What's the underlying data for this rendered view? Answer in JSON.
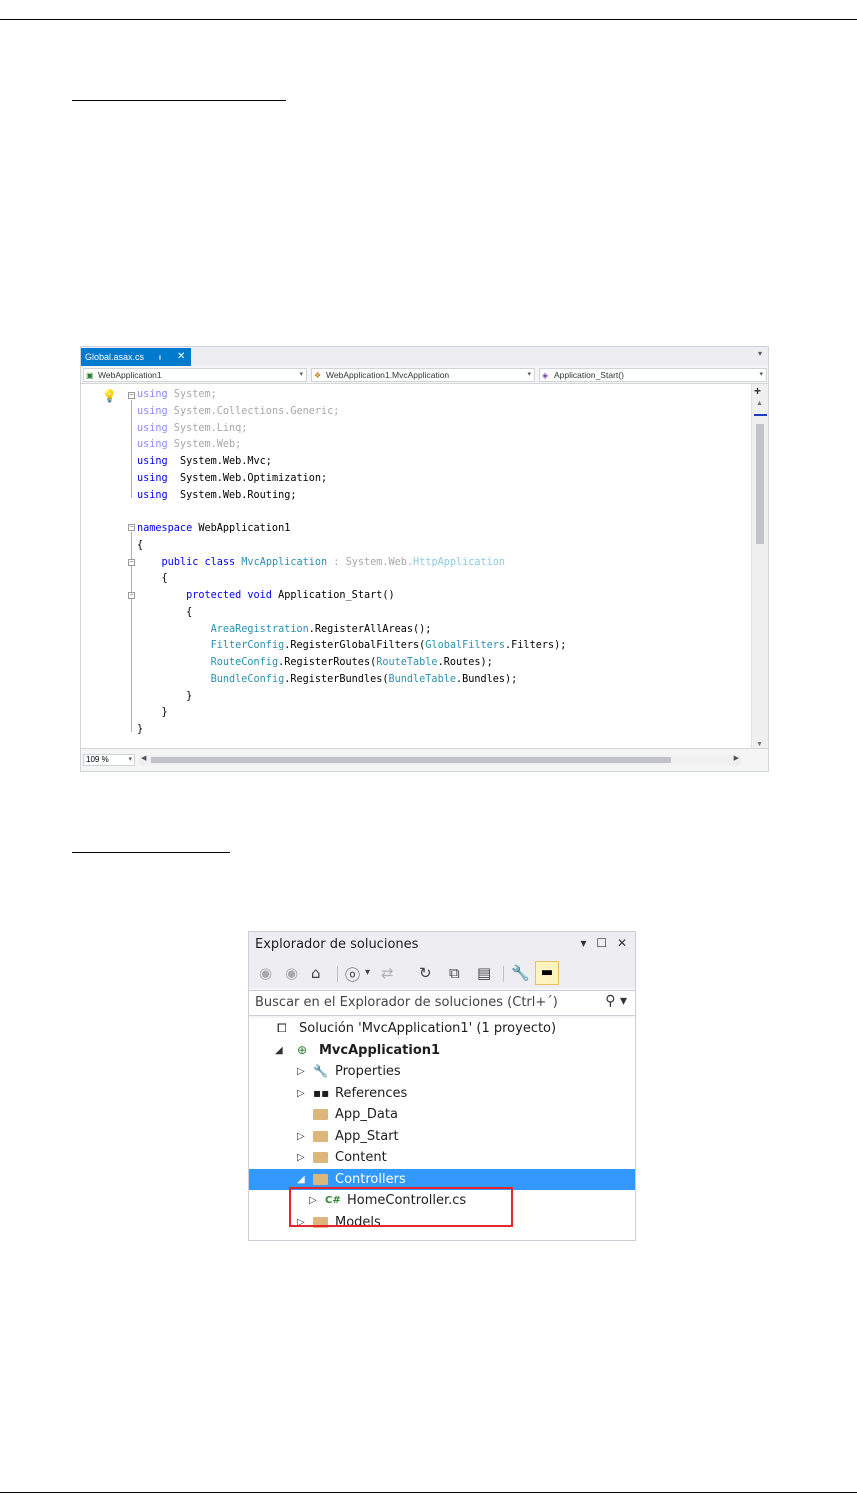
{
  "editor": {
    "tab": {
      "label": "Global.asax.cs",
      "pin": "ᵻ",
      "close": "✕"
    },
    "nav": {
      "project": "WebApplication1",
      "class": "WebApplication1.MvcApplication",
      "member": "Application_Start()"
    },
    "zoom": "109 %",
    "code": [
      [
        [
          "kw-dim",
          "using"
        ],
        [
          "dim",
          " System;"
        ]
      ],
      [
        [
          "kw-dim",
          "using"
        ],
        [
          "dim",
          " System.Collections.Generic;"
        ]
      ],
      [
        [
          "kw-dim",
          "using"
        ],
        [
          "dim",
          " System.Linq;"
        ]
      ],
      [
        [
          "kw-dim",
          "using"
        ],
        [
          "dim",
          " System.Web;"
        ]
      ],
      [
        [
          "kw",
          "using"
        ],
        [
          "",
          "  System.Web.Mvc;"
        ]
      ],
      [
        [
          "kw",
          "using"
        ],
        [
          "",
          "  System.Web.Optimization;"
        ]
      ],
      [
        [
          "kw",
          "using"
        ],
        [
          "",
          "  System.Web.Routing;"
        ]
      ],
      [],
      [
        [
          "kw",
          "namespace"
        ],
        [
          "",
          " WebApplication1"
        ]
      ],
      [
        [
          "",
          "{"
        ]
      ],
      [
        [
          "",
          "    "
        ],
        [
          "kw",
          "public class"
        ],
        [
          "",
          " "
        ],
        [
          "type",
          "MvcApplication"
        ],
        [
          "dim",
          " : System.Web."
        ],
        [
          "type-dim",
          "HttpApplication"
        ]
      ],
      [
        [
          "",
          "    {"
        ]
      ],
      [
        [
          "",
          "        "
        ],
        [
          "kw",
          "protected void"
        ],
        [
          "",
          " Application_Start()"
        ]
      ],
      [
        [
          "",
          "        {"
        ]
      ],
      [
        [
          "",
          "            "
        ],
        [
          "type",
          "AreaRegistration"
        ],
        [
          "",
          ".RegisterAllAreas();"
        ]
      ],
      [
        [
          "",
          "            "
        ],
        [
          "type",
          "FilterConfig"
        ],
        [
          "",
          ".RegisterGlobalFilters("
        ],
        [
          "type",
          "GlobalFilters"
        ],
        [
          "",
          ".Filters);"
        ]
      ],
      [
        [
          "",
          "            "
        ],
        [
          "type",
          "RouteConfig"
        ],
        [
          "",
          ".RegisterRoutes("
        ],
        [
          "type",
          "RouteTable"
        ],
        [
          "",
          ".Routes);"
        ]
      ],
      [
        [
          "",
          "            "
        ],
        [
          "type",
          "BundleConfig"
        ],
        [
          "",
          ".RegisterBundles("
        ],
        [
          "type",
          "BundleTable"
        ],
        [
          "",
          ".Bundles);"
        ]
      ],
      [
        [
          "",
          "        }"
        ]
      ],
      [
        [
          "",
          "    }"
        ]
      ],
      [
        [
          "",
          "}"
        ]
      ]
    ]
  },
  "explorer": {
    "title": "Explorador de soluciones",
    "search_placeholder": "Buscar en el Explorador de soluciones (Ctrl+´)",
    "tree": [
      {
        "label": "Solución 'MvcApplication1'  (1 proyecto)",
        "level": 0,
        "icon": "solution",
        "expander": ""
      },
      {
        "label": "MvcApplication1",
        "level": 1,
        "icon": "project",
        "expander": "◢",
        "bold": true
      },
      {
        "label": "Properties",
        "level": 2,
        "icon": "wrench",
        "expander": "▷"
      },
      {
        "label": "References",
        "level": 2,
        "icon": "references",
        "expander": "▷"
      },
      {
        "label": "App_Data",
        "level": 2,
        "icon": "folder",
        "expander": ""
      },
      {
        "label": "App_Start",
        "level": 2,
        "icon": "folder",
        "expander": "▷"
      },
      {
        "label": "Content",
        "level": 2,
        "icon": "folder",
        "expander": "▷"
      },
      {
        "label": "Controllers",
        "level": 2,
        "icon": "folder",
        "expander": "◢",
        "selected": true
      },
      {
        "label": "HomeController.cs",
        "level": 3,
        "icon": "csharp",
        "expander": "▷"
      },
      {
        "label": "Models",
        "level": 2,
        "icon": "folder",
        "expander": "▷"
      }
    ]
  },
  "colors": {
    "accent": "#007acc",
    "selection": "#3399ff",
    "highlight_box": "#e4262c"
  }
}
